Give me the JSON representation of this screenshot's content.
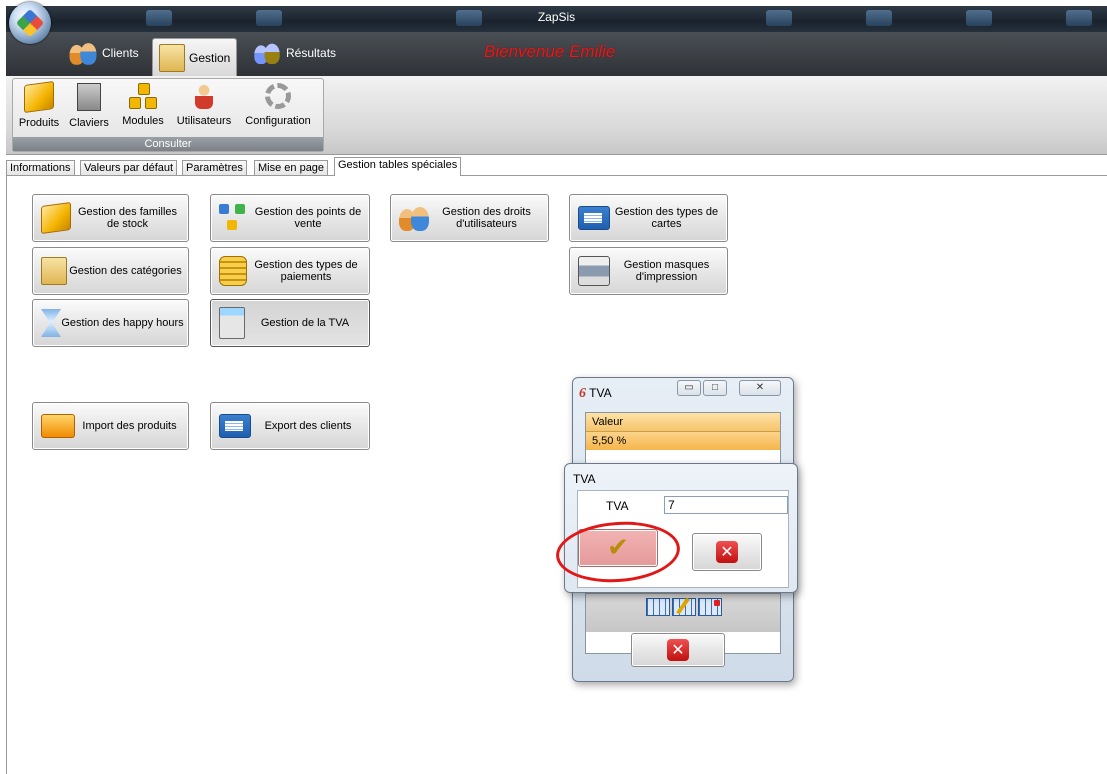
{
  "app": {
    "title": "ZapSis",
    "welcome": "Bienvenue Emilie"
  },
  "ribbon_tabs": [
    {
      "label": "Clients",
      "icon": "clients-icon"
    },
    {
      "label": "Gestion",
      "icon": "gestion-icon",
      "active": true
    },
    {
      "label": "Résultats",
      "icon": "resultats-icon"
    }
  ],
  "ribbon": {
    "group_label": "Consulter",
    "buttons": [
      {
        "label": "Produits",
        "icon": "box-icon"
      },
      {
        "label": "Claviers",
        "icon": "keyboard-icon"
      },
      {
        "label": "Modules",
        "icon": "modules-icon"
      },
      {
        "label": "Utilisateurs",
        "icon": "user-icon"
      },
      {
        "label": "Configuration",
        "icon": "gear-icon"
      }
    ]
  },
  "doc_tabs": [
    "Informations",
    "Valeurs par défaut",
    "Paramètres",
    "Mise en page",
    "Gestion tables spéciales"
  ],
  "active_doc_tab": "Gestion tables spéciales",
  "buttons": {
    "familles": "Gestion des familles de stock",
    "points_vente": "Gestion des points de vente",
    "droits": "Gestion des droits d'utilisateurs",
    "types_cartes": "Gestion des types de cartes",
    "categories": "Gestion des catégories",
    "types_paiements": "Gestion des types de paiements",
    "masques": "Gestion masques d'impression",
    "happy_hours": "Gestion des happy hours",
    "tva": "Gestion de la TVA",
    "import_produits": "Import des produits",
    "export_clients": "Export des clients"
  },
  "tva_window": {
    "title": "TVA",
    "title_glyph": "6",
    "column_header": "Valeur",
    "rows": [
      "5,50 %"
    ]
  },
  "tva_dialog": {
    "title": "TVA",
    "field_label": "TVA",
    "field_value": "7"
  },
  "colors": {
    "welcome": "#e21b1b",
    "highlight_ring": "#e01818",
    "row_selected": "#f8c870"
  }
}
